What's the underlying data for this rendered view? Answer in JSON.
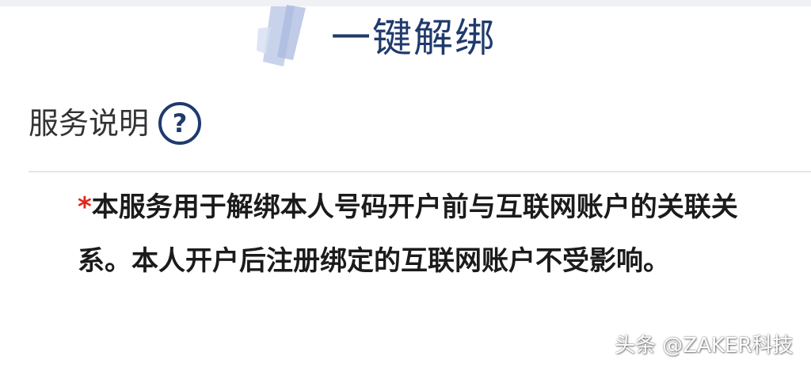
{
  "header": {
    "title": "一键解绑"
  },
  "service": {
    "label": "服务说明",
    "help_symbol": "?"
  },
  "notice": {
    "required_mark": "*",
    "text": "本服务用于解绑本人号码开户前与互联网账户的关联关系。本人开户后注册绑定的互联网账户不受影响。"
  },
  "watermark": {
    "text": "头条 @ZAKER科技"
  },
  "colors": {
    "title_blue": "#1f3a6d",
    "accent_light_blue": "#c2cee9",
    "required_red": "#e1251b",
    "text_dark": "#1b1b1b",
    "text_gray": "#333333"
  },
  "icons": {
    "title_decoration": "brush-stroke-decoration",
    "help": "question-circle-icon"
  }
}
